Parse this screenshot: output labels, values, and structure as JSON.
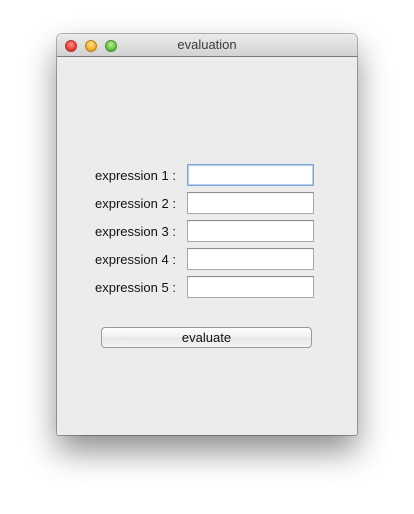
{
  "window": {
    "title": "evaluation"
  },
  "form": {
    "rows": [
      {
        "label": "expression 1 :",
        "value": "",
        "placeholder": ""
      },
      {
        "label": "expression 2 :",
        "value": "",
        "placeholder": ""
      },
      {
        "label": "expression 3 :",
        "value": "",
        "placeholder": ""
      },
      {
        "label": "expression 4 :",
        "value": "",
        "placeholder": ""
      },
      {
        "label": "expression 5 :",
        "value": "",
        "placeholder": ""
      }
    ],
    "button_label": "evaluate"
  },
  "icons": {
    "close": "close-icon",
    "minimize": "minimize-icon",
    "zoom": "zoom-icon"
  },
  "colors": {
    "window_background": "#ececec",
    "focus_ring": "#7ea6d6",
    "close": "#f0443d",
    "minimize": "#f4b33a",
    "zoom": "#6fc748"
  }
}
